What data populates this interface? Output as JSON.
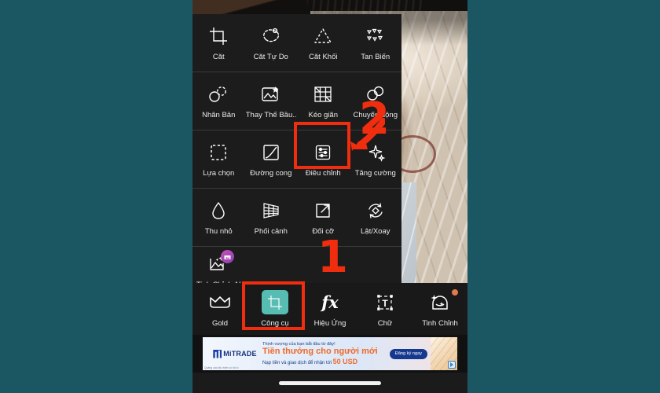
{
  "app": {
    "background_color": "#1a5763",
    "sheet_color": "#1c1c1c",
    "accent_teal": "#57bdb2",
    "annotation_color": "#f02d0e"
  },
  "tool_sheet": {
    "rows": [
      {
        "items": [
          {
            "label": "Cắt",
            "icon": "crop-icon"
          },
          {
            "label": "Cắt Tự Do",
            "icon": "lasso-cut-icon"
          },
          {
            "label": "Cắt Khối",
            "icon": "shape-cut-icon"
          },
          {
            "label": "Tan Biến",
            "icon": "dispersion-icon"
          }
        ]
      },
      {
        "items": [
          {
            "label": "Nhân Bản",
            "icon": "clone-icon"
          },
          {
            "label": "Thay Thế Bầu...",
            "icon": "sky-replace-icon"
          },
          {
            "label": "Kéo giãn",
            "icon": "stretch-grid-icon"
          },
          {
            "label": "Chuyển động",
            "icon": "motion-icon"
          }
        ]
      },
      {
        "items": [
          {
            "label": "Lựa chọn",
            "icon": "selection-icon"
          },
          {
            "label": "Đường cong",
            "icon": "curves-icon"
          },
          {
            "label": "Điều chỉnh",
            "icon": "adjust-sliders-icon",
            "highlighted": true
          },
          {
            "label": "Tăng cường",
            "icon": "enhance-icon"
          }
        ]
      },
      {
        "items": [
          {
            "label": "Thu nhỏ",
            "icon": "liquify-drop-icon"
          },
          {
            "label": "Phối cảnh",
            "icon": "perspective-icon"
          },
          {
            "label": "Đổi cỡ",
            "icon": "resize-icon"
          },
          {
            "label": "Lật/Xoay",
            "icon": "flip-rotate-icon"
          }
        ]
      },
      {
        "items": [
          {
            "label": "Tinh Chỉnh AI",
            "icon": "ai-retouch-icon",
            "badge": "ai-sparkle-badge"
          }
        ]
      }
    ]
  },
  "bottom_nav": {
    "items": [
      {
        "label": "Gold",
        "icon": "crown-icon",
        "selected": false
      },
      {
        "label": "Công cụ",
        "icon": "tools-crop-icon",
        "selected": true
      },
      {
        "label": "Hiệu Ứng",
        "icon": "fx-icon",
        "selected": false
      },
      {
        "label": "Chữ",
        "icon": "text-t-icon",
        "selected": false
      },
      {
        "label": "Tinh Chỉnh",
        "icon": "portrait-retouch-icon",
        "selected": false,
        "has_dot": true
      }
    ]
  },
  "ad": {
    "brand": "MiTRADE",
    "line1": "Thịnh vượng của bạn bắt đầu từ đây!",
    "headline": "Tiền thưởng cho người mới",
    "line3_prefix": "Nạp tiền và giao dịch để nhận tới",
    "amount": "50 USD",
    "cta": "Đăng ký ngay",
    "disclaimer": "Quảng cáo tài chính có rủi ro",
    "adchoices_icon": "adchoices-icon"
  },
  "annotations": [
    {
      "label": "1",
      "target": "Công cụ"
    },
    {
      "label": "2",
      "target": "Điều chỉnh"
    }
  ],
  "system": {
    "home_indicator": "home-indicator"
  }
}
